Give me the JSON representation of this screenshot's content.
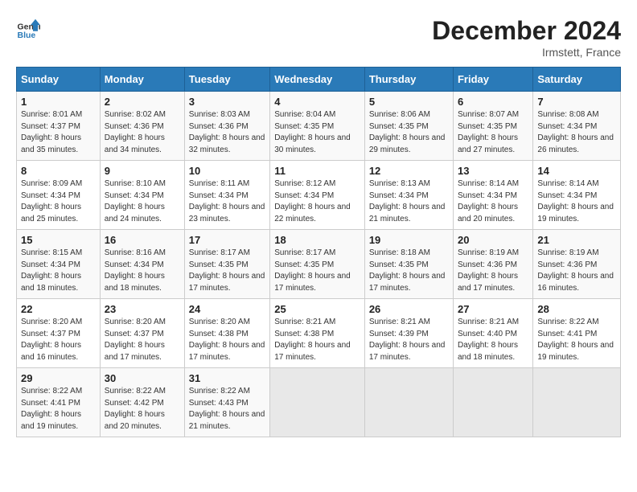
{
  "header": {
    "logo_line1": "General",
    "logo_line2": "Blue",
    "month_title": "December 2024",
    "location": "Irmstett, France"
  },
  "days_of_week": [
    "Sunday",
    "Monday",
    "Tuesday",
    "Wednesday",
    "Thursday",
    "Friday",
    "Saturday"
  ],
  "weeks": [
    [
      {
        "day": "1",
        "sunrise": "8:01 AM",
        "sunset": "4:37 PM",
        "daylight": "8 hours and 35 minutes."
      },
      {
        "day": "2",
        "sunrise": "8:02 AM",
        "sunset": "4:36 PM",
        "daylight": "8 hours and 34 minutes."
      },
      {
        "day": "3",
        "sunrise": "8:03 AM",
        "sunset": "4:36 PM",
        "daylight": "8 hours and 32 minutes."
      },
      {
        "day": "4",
        "sunrise": "8:04 AM",
        "sunset": "4:35 PM",
        "daylight": "8 hours and 30 minutes."
      },
      {
        "day": "5",
        "sunrise": "8:06 AM",
        "sunset": "4:35 PM",
        "daylight": "8 hours and 29 minutes."
      },
      {
        "day": "6",
        "sunrise": "8:07 AM",
        "sunset": "4:35 PM",
        "daylight": "8 hours and 27 minutes."
      },
      {
        "day": "7",
        "sunrise": "8:08 AM",
        "sunset": "4:34 PM",
        "daylight": "8 hours and 26 minutes."
      }
    ],
    [
      {
        "day": "8",
        "sunrise": "8:09 AM",
        "sunset": "4:34 PM",
        "daylight": "8 hours and 25 minutes."
      },
      {
        "day": "9",
        "sunrise": "8:10 AM",
        "sunset": "4:34 PM",
        "daylight": "8 hours and 24 minutes."
      },
      {
        "day": "10",
        "sunrise": "8:11 AM",
        "sunset": "4:34 PM",
        "daylight": "8 hours and 23 minutes."
      },
      {
        "day": "11",
        "sunrise": "8:12 AM",
        "sunset": "4:34 PM",
        "daylight": "8 hours and 22 minutes."
      },
      {
        "day": "12",
        "sunrise": "8:13 AM",
        "sunset": "4:34 PM",
        "daylight": "8 hours and 21 minutes."
      },
      {
        "day": "13",
        "sunrise": "8:14 AM",
        "sunset": "4:34 PM",
        "daylight": "8 hours and 20 minutes."
      },
      {
        "day": "14",
        "sunrise": "8:14 AM",
        "sunset": "4:34 PM",
        "daylight": "8 hours and 19 minutes."
      }
    ],
    [
      {
        "day": "15",
        "sunrise": "8:15 AM",
        "sunset": "4:34 PM",
        "daylight": "8 hours and 18 minutes."
      },
      {
        "day": "16",
        "sunrise": "8:16 AM",
        "sunset": "4:34 PM",
        "daylight": "8 hours and 18 minutes."
      },
      {
        "day": "17",
        "sunrise": "8:17 AM",
        "sunset": "4:35 PM",
        "daylight": "8 hours and 17 minutes."
      },
      {
        "day": "18",
        "sunrise": "8:17 AM",
        "sunset": "4:35 PM",
        "daylight": "8 hours and 17 minutes."
      },
      {
        "day": "19",
        "sunrise": "8:18 AM",
        "sunset": "4:35 PM",
        "daylight": "8 hours and 17 minutes."
      },
      {
        "day": "20",
        "sunrise": "8:19 AM",
        "sunset": "4:36 PM",
        "daylight": "8 hours and 17 minutes."
      },
      {
        "day": "21",
        "sunrise": "8:19 AM",
        "sunset": "4:36 PM",
        "daylight": "8 hours and 16 minutes."
      }
    ],
    [
      {
        "day": "22",
        "sunrise": "8:20 AM",
        "sunset": "4:37 PM",
        "daylight": "8 hours and 16 minutes."
      },
      {
        "day": "23",
        "sunrise": "8:20 AM",
        "sunset": "4:37 PM",
        "daylight": "8 hours and 17 minutes."
      },
      {
        "day": "24",
        "sunrise": "8:20 AM",
        "sunset": "4:38 PM",
        "daylight": "8 hours and 17 minutes."
      },
      {
        "day": "25",
        "sunrise": "8:21 AM",
        "sunset": "4:38 PM",
        "daylight": "8 hours and 17 minutes."
      },
      {
        "day": "26",
        "sunrise": "8:21 AM",
        "sunset": "4:39 PM",
        "daylight": "8 hours and 17 minutes."
      },
      {
        "day": "27",
        "sunrise": "8:21 AM",
        "sunset": "4:40 PM",
        "daylight": "8 hours and 18 minutes."
      },
      {
        "day": "28",
        "sunrise": "8:22 AM",
        "sunset": "4:41 PM",
        "daylight": "8 hours and 19 minutes."
      }
    ],
    [
      {
        "day": "29",
        "sunrise": "8:22 AM",
        "sunset": "4:41 PM",
        "daylight": "8 hours and 19 minutes."
      },
      {
        "day": "30",
        "sunrise": "8:22 AM",
        "sunset": "4:42 PM",
        "daylight": "8 hours and 20 minutes."
      },
      {
        "day": "31",
        "sunrise": "8:22 AM",
        "sunset": "4:43 PM",
        "daylight": "8 hours and 21 minutes."
      },
      null,
      null,
      null,
      null
    ]
  ]
}
